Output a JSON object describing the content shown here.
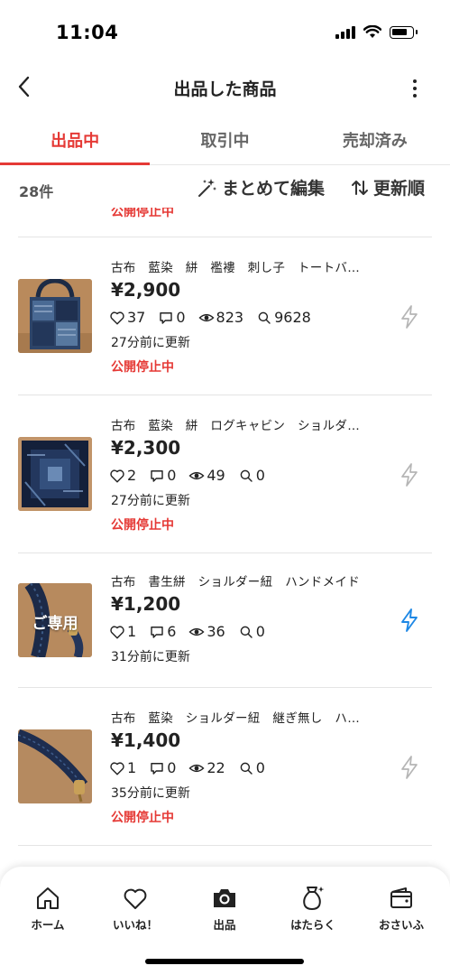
{
  "status_bar": {
    "time": "11:04"
  },
  "header": {
    "title": "出品した商品"
  },
  "tabs": [
    {
      "label": "出品中",
      "active": true
    },
    {
      "label": "取引中",
      "active": false
    },
    {
      "label": "売却済み",
      "active": false
    }
  ],
  "summary": {
    "count": "28件",
    "bulk_edit": "まとめて編集",
    "sort": "更新順"
  },
  "partial_item": {
    "status": "公開停止中"
  },
  "items": [
    {
      "title": "古布　藍染　絣　襤褸　刺し子　トートバ…",
      "price": "¥2,900",
      "likes": "37",
      "comments": "0",
      "views": "823",
      "searches": "9628",
      "updated": "27分前に更新",
      "status": "公開停止中",
      "boost_active": false
    },
    {
      "title": "古布　藍染　絣　ログキャビン　ショルダ…",
      "price": "¥2,300",
      "likes": "2",
      "comments": "0",
      "views": "49",
      "searches": "0",
      "updated": "27分前に更新",
      "status": "公開停止中",
      "boost_active": false
    },
    {
      "title": "古布　書生絣　ショルダー紐　ハンドメイド",
      "price": "¥1,200",
      "likes": "1",
      "comments": "6",
      "views": "36",
      "searches": "0",
      "updated": "31分前に更新",
      "status": "",
      "boost_active": true,
      "thumb_overlay": "ご専用"
    },
    {
      "title": "古布　藍染　ショルダー紐　継ぎ無し　ハ…",
      "price": "¥1,400",
      "likes": "1",
      "comments": "0",
      "views": "22",
      "searches": "0",
      "updated": "35分前に更新",
      "status": "公開停止中",
      "boost_active": false
    }
  ],
  "bottom_nav": [
    {
      "label": "ホーム",
      "icon": "home-icon"
    },
    {
      "label": "いいね！",
      "icon": "heart-icon"
    },
    {
      "label": "出品",
      "icon": "camera-icon"
    },
    {
      "label": "はたらく",
      "icon": "money-bag-icon"
    },
    {
      "label": "おさいふ",
      "icon": "wallet-icon"
    }
  ],
  "colors": {
    "accent": "#e53935",
    "boost_active": "#1e88e5",
    "boost_inactive": "#b5b5b5"
  }
}
